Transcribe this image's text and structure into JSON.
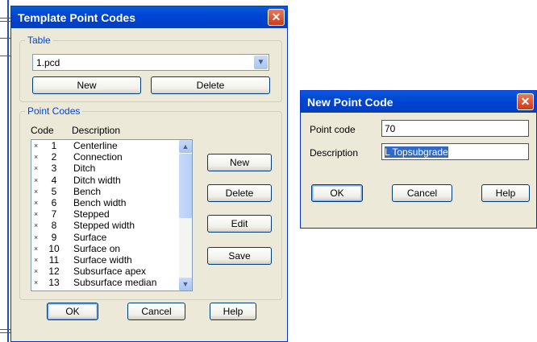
{
  "template_dialog": {
    "title": "Template Point Codes",
    "table_group": {
      "label": "Table",
      "selected": "1.pcd",
      "new_label": "New",
      "delete_label": "Delete"
    },
    "point_codes_group": {
      "label": "Point Codes",
      "col_code": "Code",
      "col_description": "Description",
      "rows": [
        {
          "mark": "×",
          "code": "1",
          "desc": "Centerline"
        },
        {
          "mark": "×",
          "code": "2",
          "desc": "Connection"
        },
        {
          "mark": "×",
          "code": "3",
          "desc": "Ditch"
        },
        {
          "mark": "×",
          "code": "4",
          "desc": "Ditch width"
        },
        {
          "mark": "×",
          "code": "5",
          "desc": "Bench"
        },
        {
          "mark": "×",
          "code": "6",
          "desc": "Bench width"
        },
        {
          "mark": "×",
          "code": "7",
          "desc": "Stepped"
        },
        {
          "mark": "×",
          "code": "8",
          "desc": "Stepped width"
        },
        {
          "mark": "×",
          "code": "9",
          "desc": "Surface"
        },
        {
          "mark": "×",
          "code": "10",
          "desc": "Surface on"
        },
        {
          "mark": "×",
          "code": "11",
          "desc": "Surface width"
        },
        {
          "mark": "×",
          "code": "12",
          "desc": "Subsurface apex"
        },
        {
          "mark": "×",
          "code": "13",
          "desc": "Subsurface median"
        }
      ],
      "new_label": "New",
      "delete_label": "Delete",
      "edit_label": "Edit",
      "save_label": "Save"
    },
    "ok_label": "OK",
    "cancel_label": "Cancel",
    "help_label": "Help"
  },
  "new_code_dialog": {
    "title": "New Point Code",
    "point_code_label": "Point code",
    "point_code_value": "70",
    "description_label": "Description",
    "description_value": "L Topsubgrade",
    "ok_label": "OK",
    "cancel_label": "Cancel",
    "help_label": "Help"
  },
  "colors": {
    "titlebar": "#0046d5",
    "close": "#cc3a17",
    "dialog_face": "#ece9d8",
    "group_label": "#0046d5",
    "selection": "#316ac5"
  }
}
